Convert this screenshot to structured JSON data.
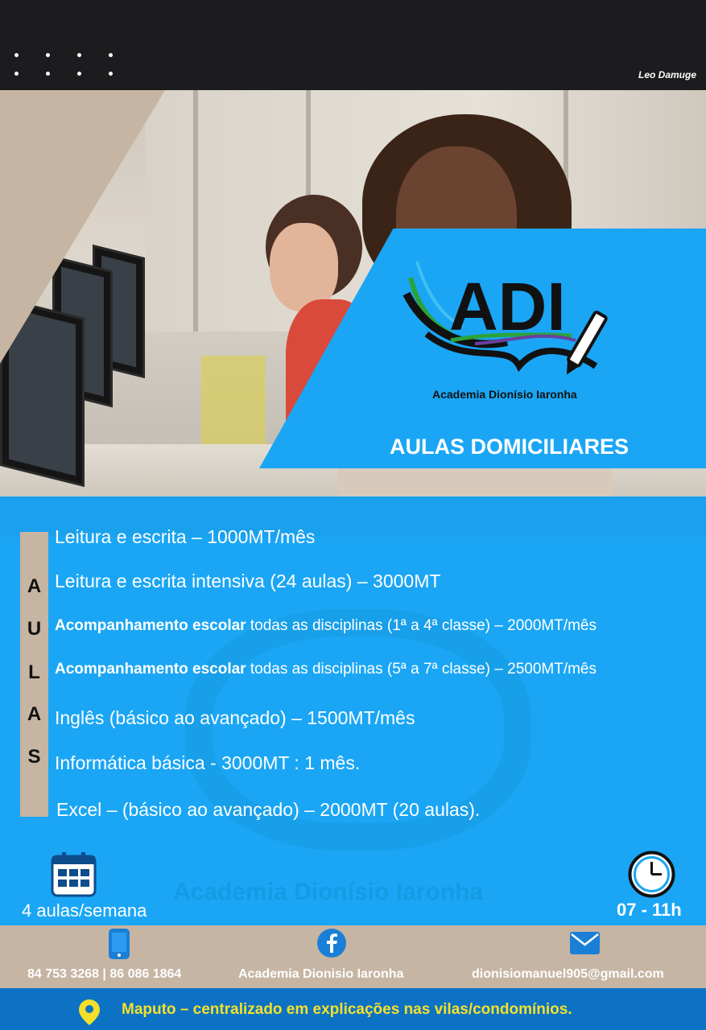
{
  "header": {
    "credit": "Leo Damuge"
  },
  "logo": {
    "text": "ADI",
    "subtitle": "Academia Dionísio Iaronha"
  },
  "headline": "AULAS DOMICILIARES",
  "side_tab": {
    "letters": [
      "A",
      "U",
      "L",
      "A",
      "S"
    ]
  },
  "items": [
    {
      "plain": "Leitura e escrita – 1000MT/mês"
    },
    {
      "plain": "Leitura e escrita intensiva (24 aulas) – 3000MT"
    },
    {
      "bold": "Acompanhamento escolar",
      "rest": " todas as disciplinas (1ª a 4ª classe) – 2000MT/mês"
    },
    {
      "bold": "Acompanhamento escolar",
      "rest": " todas as disciplinas (5ª a 7ª classe) – 2500MT/mês"
    },
    {
      "plain": "Inglês (básico ao avançado)  – 1500MT/mês"
    },
    {
      "plain": "Informática básica - 3000MT : 1 mês."
    },
    {
      "plain": "Excel – (básico ao avançado) – 2000MT (20 aulas)."
    }
  ],
  "watermark": "Academia Dionísio Iaronha",
  "schedule": {
    "frequency": "4 aulas/semana",
    "hours": "07 - 11h"
  },
  "contacts": {
    "phone": "84 753 3268  |  86 086 1864",
    "facebook": "Academia Dionisio Iaronha",
    "email": "dionisiomanuel905@gmail.com"
  },
  "location": "Maputo – centralizado em explicações nas vilas/condomínios.",
  "icons": [
    "calendar-icon",
    "clock-icon",
    "phone-icon",
    "facebook-icon",
    "mail-icon",
    "location-pin-icon",
    "pencil-icon"
  ],
  "colors": {
    "blue": "#1aa6f5",
    "tan": "#c6b5a3",
    "dark": "#1c1c1e",
    "yellow": "#f4e02a",
    "deep_blue": "#0d72c4"
  }
}
